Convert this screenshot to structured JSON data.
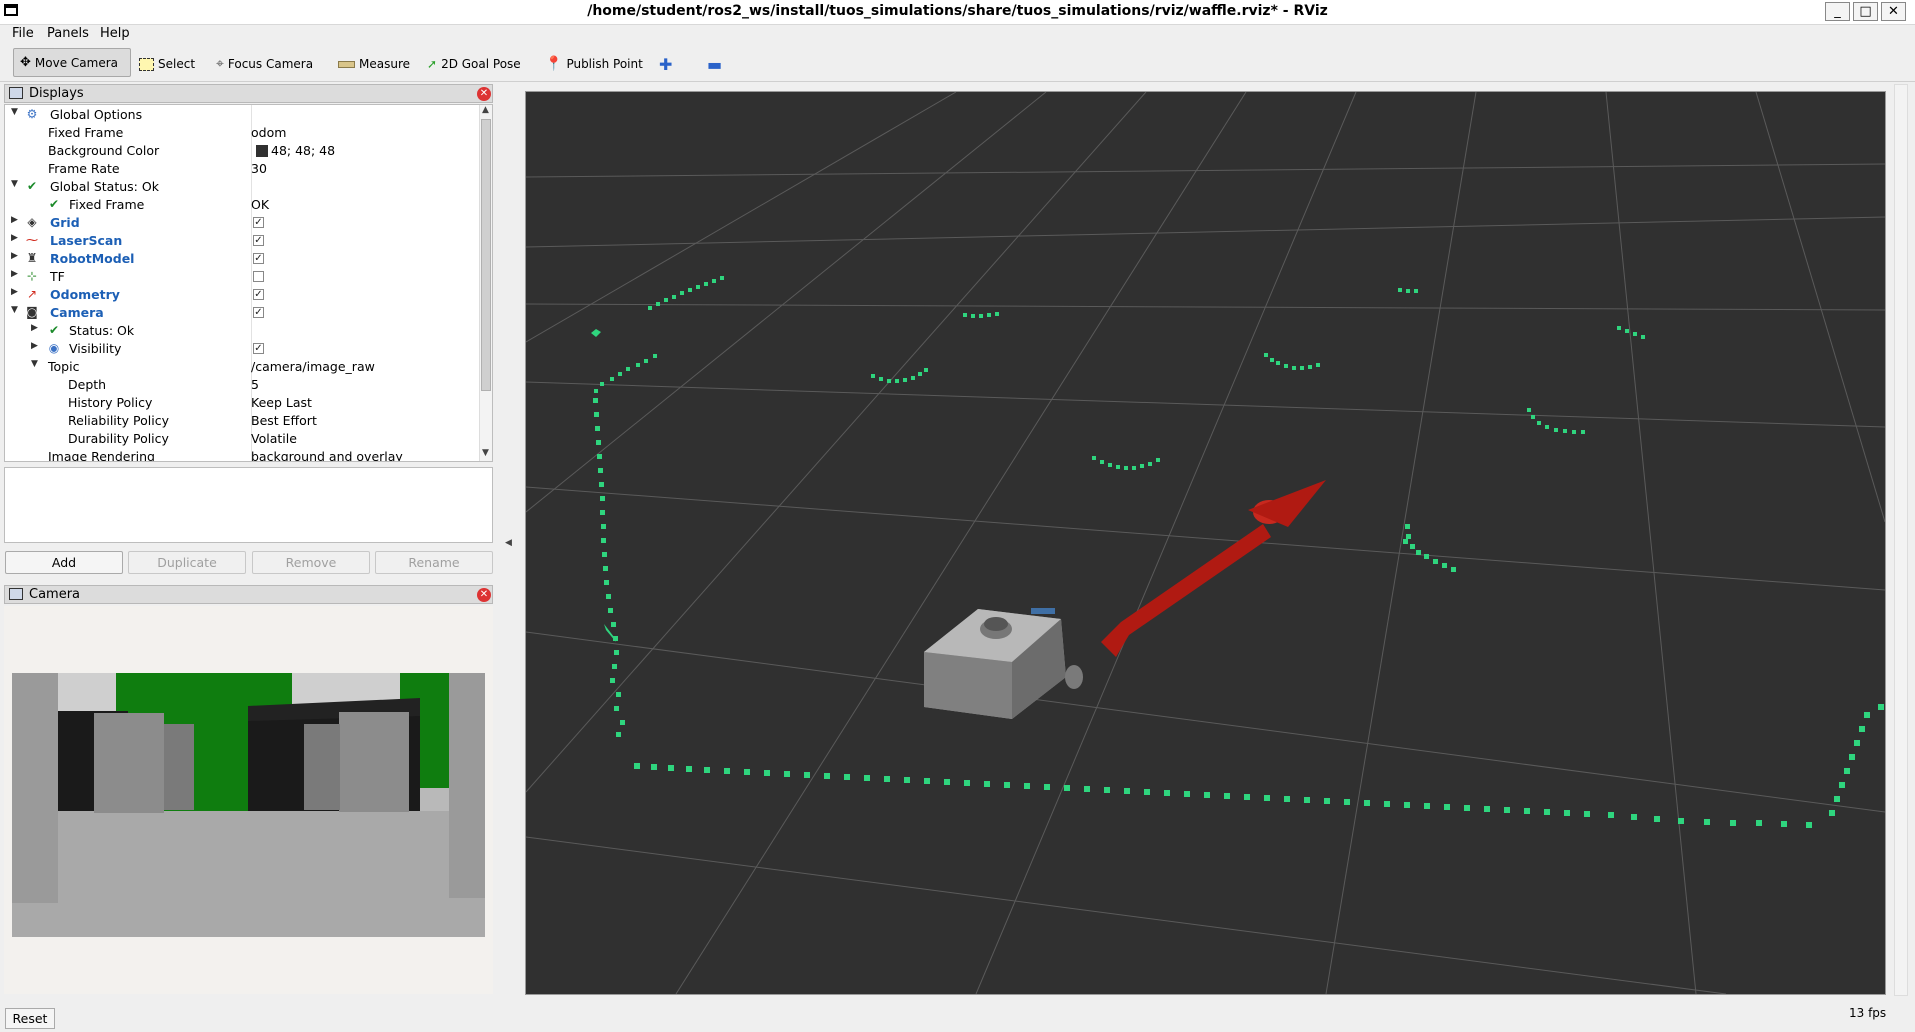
{
  "window": {
    "title": "/home/student/ros2_ws/install/tuos_simulations/share/tuos_simulations/rviz/waffle.rviz* - RViz",
    "minimize": "_",
    "maximize": "□",
    "close": "✕"
  },
  "menu": {
    "file": "File",
    "panels": "Panels",
    "help": "Help"
  },
  "toolbar": {
    "move_camera": "Move Camera",
    "select": "Select",
    "focus_camera": "Focus Camera",
    "measure": "Measure",
    "goal_pose": "2D Goal Pose",
    "publish_point": "Publish Point"
  },
  "displays": {
    "title": "Displays",
    "rows": [
      {
        "label": "Global Options",
        "value": ""
      },
      {
        "label": "Fixed Frame",
        "value": "odom"
      },
      {
        "label": "Background Color",
        "value": "48; 48; 48"
      },
      {
        "label": "Frame Rate",
        "value": "30"
      },
      {
        "label": "Global Status: Ok",
        "value": ""
      },
      {
        "label": "Fixed Frame",
        "value": "OK"
      },
      {
        "label": "Grid",
        "value": ""
      },
      {
        "label": "LaserScan",
        "value": ""
      },
      {
        "label": "RobotModel",
        "value": ""
      },
      {
        "label": "TF",
        "value": ""
      },
      {
        "label": "Odometry",
        "value": ""
      },
      {
        "label": "Camera",
        "value": ""
      },
      {
        "label": "Status: Ok",
        "value": ""
      },
      {
        "label": "Visibility",
        "value": ""
      },
      {
        "label": "Topic",
        "value": "/camera/image_raw"
      },
      {
        "label": "Depth",
        "value": "5"
      },
      {
        "label": "History Policy",
        "value": "Keep Last"
      },
      {
        "label": "Reliability Policy",
        "value": "Best Effort"
      },
      {
        "label": "Durability Policy",
        "value": "Volatile"
      },
      {
        "label": "Image Rendering",
        "value": "background and overlay"
      }
    ],
    "background_color_hex": "#303030"
  },
  "buttons": {
    "add": "Add",
    "duplicate": "Duplicate",
    "remove": "Remove",
    "rename": "Rename"
  },
  "camera_panel": {
    "title": "Camera"
  },
  "footer": {
    "reset": "Reset",
    "fps": "13 fps"
  },
  "colors": {
    "laser": "#2fd57e",
    "arrow": "#b01a12",
    "grid": "#5a5a5a",
    "viewport_bg": "#303030"
  }
}
